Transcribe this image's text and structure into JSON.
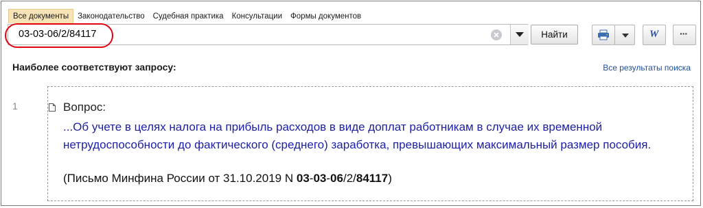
{
  "tabs": [
    {
      "label": "Все документы",
      "active": true
    },
    {
      "label": "Законодательство",
      "active": false
    },
    {
      "label": "Судебная практика",
      "active": false
    },
    {
      "label": "Консультации",
      "active": false
    },
    {
      "label": "Формы документов",
      "active": false
    }
  ],
  "search": {
    "value": "03-03-06/2/84117"
  },
  "toolbar": {
    "find_label": "Найти",
    "word_label": "W",
    "more_label": "···"
  },
  "results": {
    "heading": "Наиболее соответствуют запросу:",
    "all_link": "Все результаты поиска",
    "item": {
      "number": "1",
      "label": "Вопрос:",
      "title": "...Об учете в целях налога на прибыль расходов в виде доплат работникам в случае их временной нетрудоспособности до фактического (среднего) заработка, превышающих максимальный размер пособия.",
      "source_prefix": "(Письмо Минфина России от 31.10.2019 N ",
      "source_parts": [
        "03",
        "-",
        "03",
        "-",
        "06",
        "/2/",
        "84117"
      ],
      "source_suffix": ")"
    }
  },
  "colors": {
    "accent": "#e3000f",
    "link": "#1b1fa6",
    "active_tab": "#f6e3b6"
  }
}
